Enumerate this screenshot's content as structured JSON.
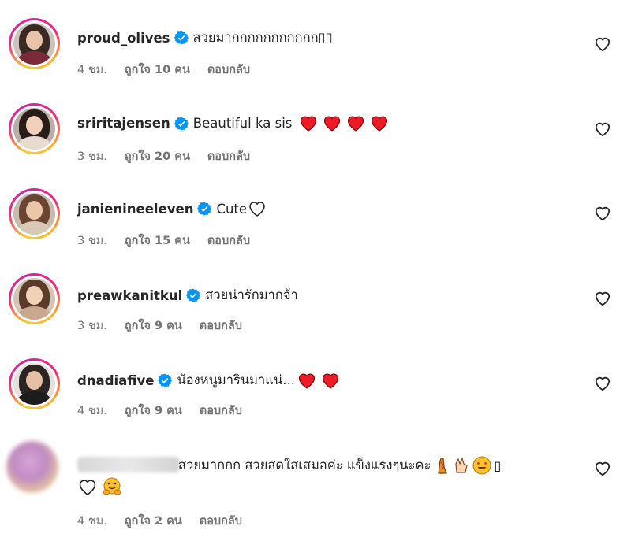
{
  "comments": [
    {
      "username": "proud_olives",
      "text": "สวยมากกกกกกกกกกก▯▯",
      "time": "4 ชม.",
      "likes": "ถูกใจ 10 คน",
      "reply": "ตอบกลับ"
    },
    {
      "username": "sriritajensen",
      "text": "Beautiful ka sis",
      "time": "3 ชม.",
      "likes": "ถูกใจ 20 คน",
      "reply": "ตอบกลับ"
    },
    {
      "username": "janienineeleven",
      "text": "Cute",
      "time": "3 ชม.",
      "likes": "ถูกใจ 15 คน",
      "reply": "ตอบกลับ"
    },
    {
      "username": "preawkanitkul",
      "text": "สวยน่ารักมากจ้า",
      "time": "3 ชม.",
      "likes": "ถูกใจ 9 คน",
      "reply": "ตอบกลับ"
    },
    {
      "username": "dnadiafive",
      "text": "น้องหนูมารินมาแน่...",
      "time": "4 ชม.",
      "likes": "ถูกใจ 9 คน",
      "reply": "ตอบกลับ"
    },
    {
      "username": "",
      "text": "สวยมากกก สวยสดใสเสมอค่ะ แข็งแรงๆนะคะ",
      "text_end": "▯",
      "time": "4 ชม.",
      "likes": "ถูกใจ 2 คน",
      "reply": "ตอบกลับ"
    }
  ],
  "icons": {
    "like": "heart-outline-icon",
    "verified": "verified-badge-icon"
  },
  "colors": {
    "verified_blue": "#0095f6",
    "heart_red": "#ed1c24",
    "meta_gray": "#737373"
  }
}
